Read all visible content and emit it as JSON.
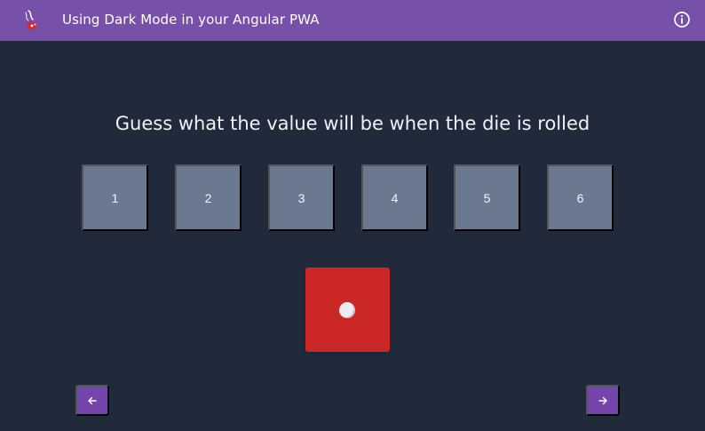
{
  "header": {
    "title": "Using Dark Mode in your Angular PWA",
    "logo_icon": "dice-logo-icon",
    "info_icon": "info-icon",
    "background": "#7650a9"
  },
  "game": {
    "prompt": "Guess what the value will be when the die is rolled",
    "choices": [
      "1",
      "2",
      "3",
      "4",
      "5",
      "6"
    ],
    "die_value": 1,
    "die_color": "#cc2727",
    "choice_color": "#6a7890"
  },
  "navigation": {
    "previous_icon": "arrow-left-icon",
    "next_icon": "arrow-right-icon",
    "button_color": "#7445aa"
  }
}
